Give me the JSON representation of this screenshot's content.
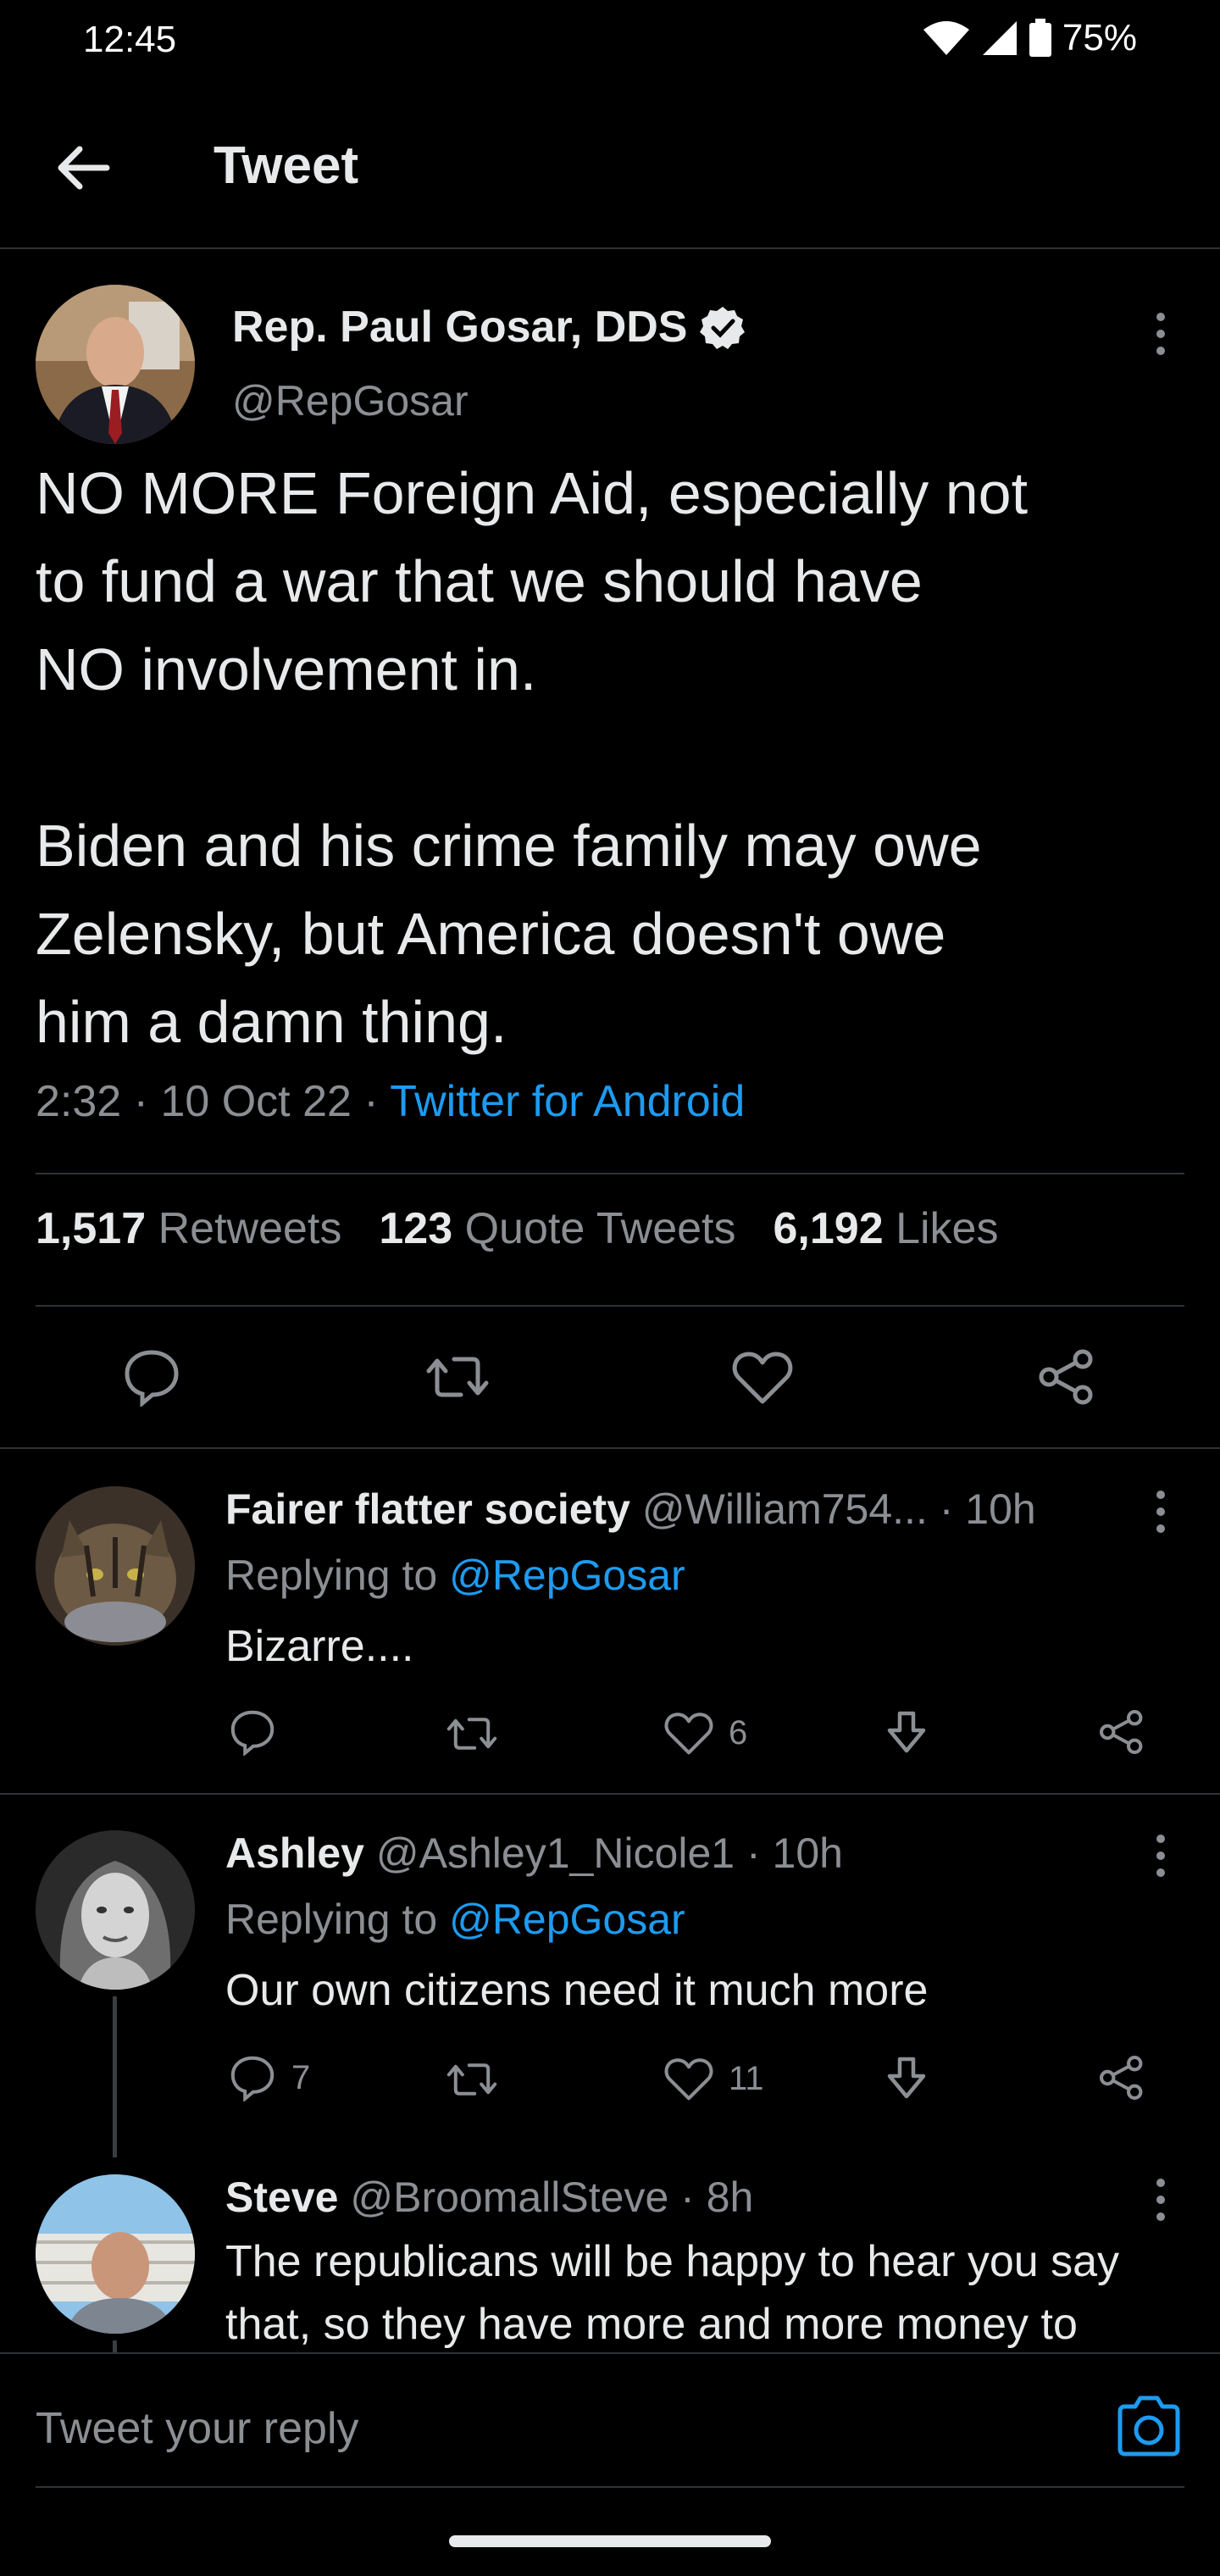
{
  "status_bar": {
    "time": "12:45",
    "battery": "75%"
  },
  "nav": {
    "title": "Tweet"
  },
  "tweet": {
    "author_name": "Rep. Paul Gosar, DDS",
    "author_handle": "@RepGosar",
    "text": "NO MORE Foreign Aid, especially not\nto fund a war that we should have\nNO involvement in.\n\nBiden and his crime family may owe\nZelensky, but America doesn't owe\nhim a damn thing.",
    "time": "2:32",
    "date": "10 Oct 22",
    "source": "Twitter for Android",
    "retweets_count": "1,517",
    "retweets_label": "Retweets",
    "quotes_count": "123",
    "quotes_label": "Quote Tweets",
    "likes_count": "6,192",
    "likes_label": "Likes"
  },
  "replies": [
    {
      "name": "Fairer flatter society",
      "handle": "@William754...",
      "time": "· 10h",
      "replying_label": "Replying to",
      "replying_to": "@RepGosar",
      "text": "Bizarre....",
      "reply_count": "",
      "like_count": "6"
    },
    {
      "name": "Ashley",
      "handle": "@Ashley1_Nicole1",
      "time": "· 10h",
      "replying_label": "Replying to",
      "replying_to": "@RepGosar",
      "text": "Our own citizens need it much more",
      "reply_count": "7",
      "like_count": "11"
    },
    {
      "name": "Steve",
      "handle": "@BroomallSteve",
      "time": "· 8h",
      "text": "The republicans will be happy to hear you say that, so they have more and more money to"
    }
  ],
  "composer": {
    "placeholder": "Tweet your reply"
  },
  "colors": {
    "background": "#000000",
    "accent": "#1d9bf0",
    "muted": "#8b8f94",
    "divider": "#2f3336"
  }
}
